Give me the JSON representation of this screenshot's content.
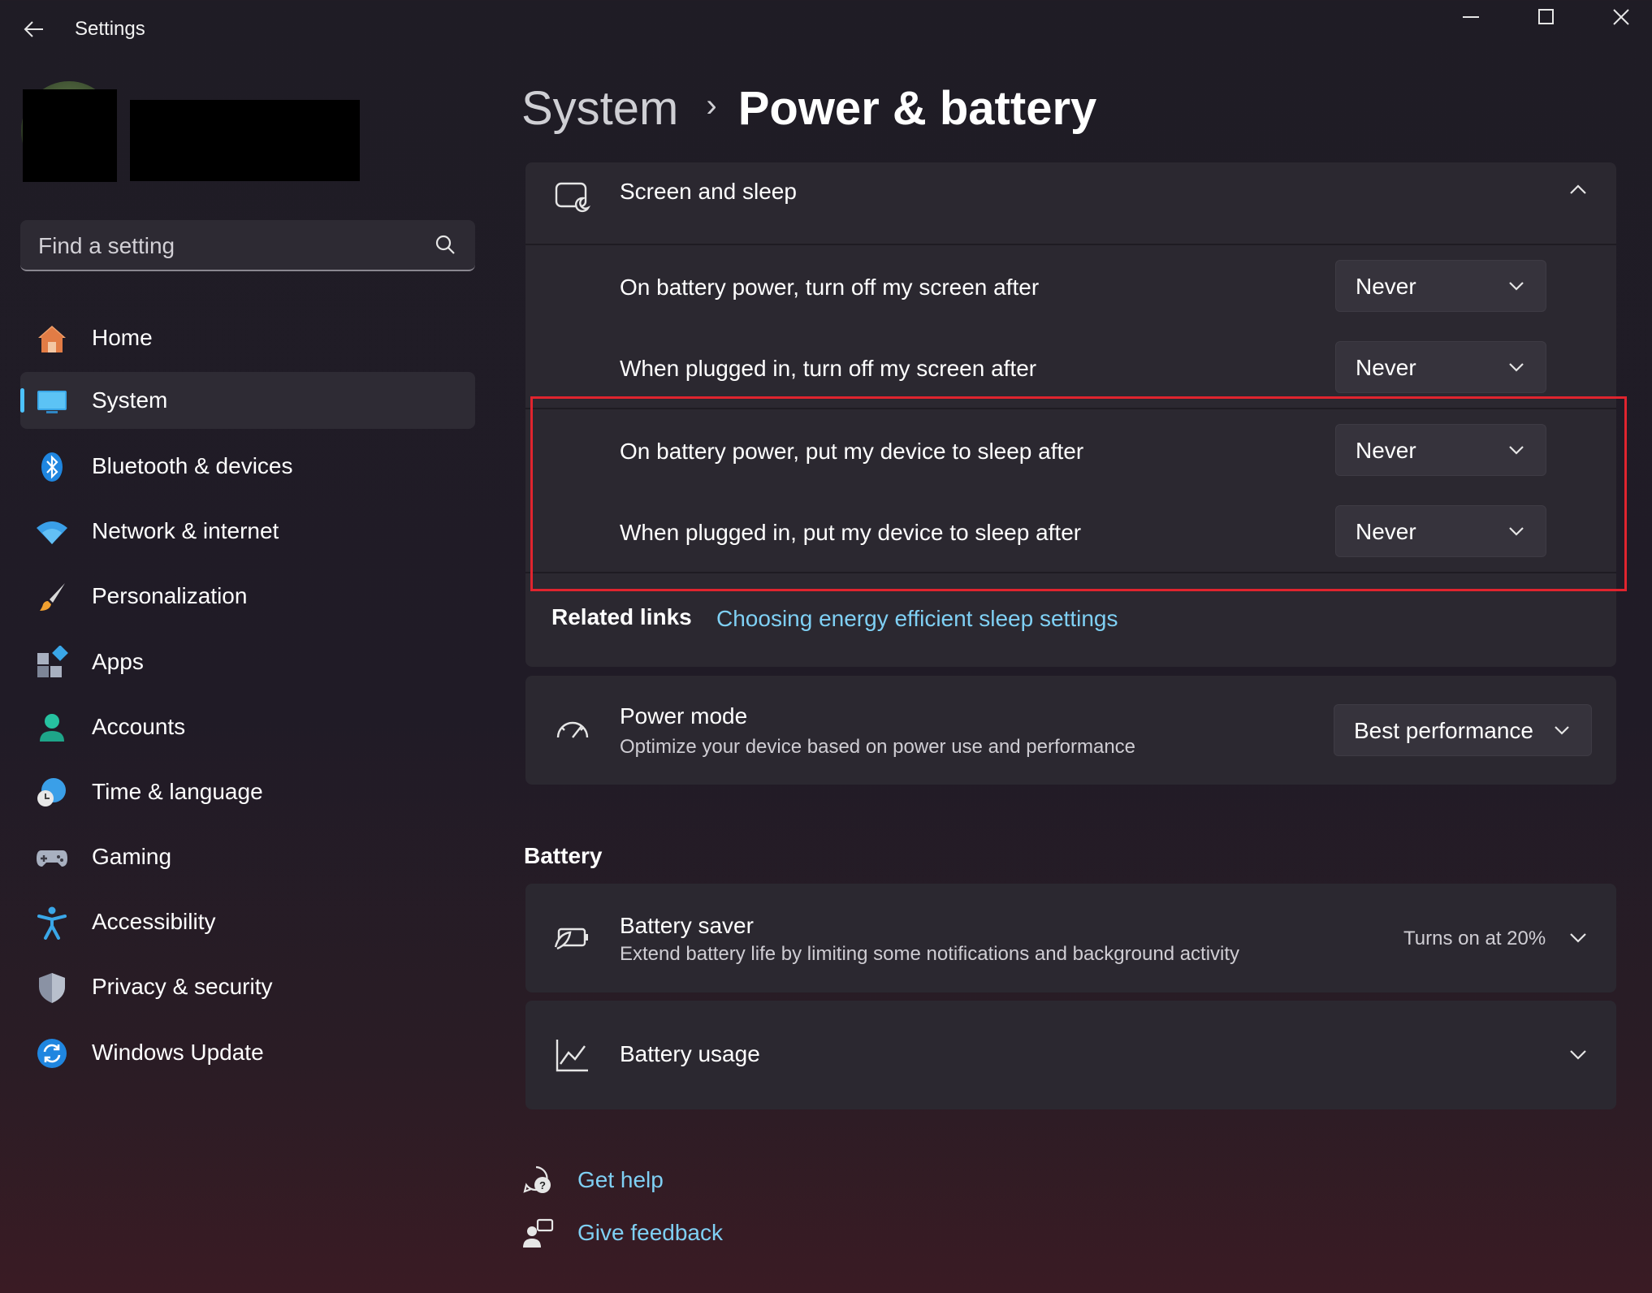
{
  "window": {
    "title": "Settings",
    "back_icon": "back-arrow-icon",
    "controls": [
      "minimize-icon",
      "maximize-icon",
      "close-icon"
    ]
  },
  "search": {
    "placeholder": "Find a setting"
  },
  "nav": [
    {
      "label": "Home",
      "icon": "home-icon"
    },
    {
      "label": "System",
      "icon": "monitor-icon",
      "active": true
    },
    {
      "label": "Bluetooth & devices",
      "icon": "bluetooth-icon"
    },
    {
      "label": "Network & internet",
      "icon": "wifi-icon"
    },
    {
      "label": "Personalization",
      "icon": "paintbrush-icon"
    },
    {
      "label": "Apps",
      "icon": "apps-icon"
    },
    {
      "label": "Accounts",
      "icon": "person-icon"
    },
    {
      "label": "Time & language",
      "icon": "globe-clock-icon"
    },
    {
      "label": "Gaming",
      "icon": "gamepad-icon"
    },
    {
      "label": "Accessibility",
      "icon": "accessibility-icon"
    },
    {
      "label": "Privacy & security",
      "icon": "shield-icon"
    },
    {
      "label": "Windows Update",
      "icon": "sync-icon"
    }
  ],
  "breadcrumb": {
    "parent": "System",
    "separator": "›",
    "current": "Power & battery"
  },
  "screen_sleep": {
    "title": "Screen and sleep",
    "rows": [
      {
        "label": "On battery power, turn off my screen after",
        "value": "Never"
      },
      {
        "label": "When plugged in, turn off my screen after",
        "value": "Never"
      },
      {
        "label": "On battery power, put my device to sleep after",
        "value": "Never"
      },
      {
        "label": "When plugged in, put my device to sleep after",
        "value": "Never"
      }
    ],
    "related_label": "Related links",
    "related_link": "Choosing energy efficient sleep settings"
  },
  "power_mode": {
    "title": "Power mode",
    "subtitle": "Optimize your device based on power use and performance",
    "value": "Best performance"
  },
  "battery": {
    "section_title": "Battery",
    "saver": {
      "title": "Battery saver",
      "subtitle": "Extend battery life by limiting some notifications and background activity",
      "status": "Turns on at 20%"
    },
    "usage": {
      "title": "Battery usage"
    }
  },
  "footer": {
    "help": "Get help",
    "feedback": "Give feedback"
  },
  "colors": {
    "accent": "#4cc2ff",
    "link": "#7fd0f4",
    "highlight": "#e0242e"
  }
}
